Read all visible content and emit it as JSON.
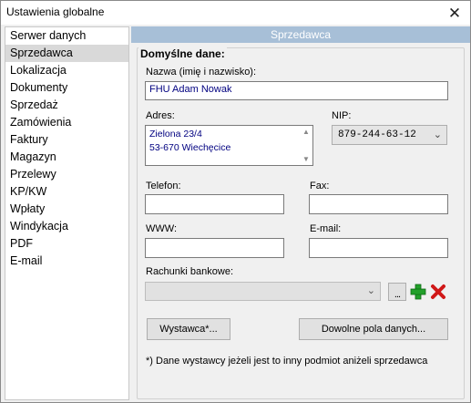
{
  "window": {
    "title": "Ustawienia globalne",
    "close_icon": "close-icon"
  },
  "sidebar": {
    "items": [
      {
        "label": "Serwer danych"
      },
      {
        "label": "Sprzedawca"
      },
      {
        "label": "Lokalizacja"
      },
      {
        "label": "Dokumenty"
      },
      {
        "label": "Sprzedaż"
      },
      {
        "label": "Zamówienia"
      },
      {
        "label": "Faktury"
      },
      {
        "label": "Magazyn"
      },
      {
        "label": "Przelewy"
      },
      {
        "label": "KP/KW"
      },
      {
        "label": "Wpłaty"
      },
      {
        "label": "Windykacja"
      },
      {
        "label": "PDF"
      },
      {
        "label": "E-mail"
      }
    ],
    "selected": "Sprzedawca"
  },
  "panel": {
    "header": "Sprzedawca",
    "group_title": "Domyślne dane:",
    "name": {
      "label": "Nazwa (imię i nazwisko):",
      "value": "FHU Adam Nowak"
    },
    "address": {
      "label": "Adres:",
      "lines": [
        "Zielona 23/4",
        "53-670 Wiechęcice"
      ]
    },
    "nip": {
      "label": "NIP:",
      "value": "879-244-63-12"
    },
    "phone": {
      "label": "Telefon:",
      "value": ""
    },
    "fax": {
      "label": "Fax:",
      "value": ""
    },
    "www": {
      "label": "WWW:",
      "value": ""
    },
    "email": {
      "label": "E-mail:",
      "value": ""
    },
    "bank": {
      "label": "Rachunki bankowe:",
      "value": ""
    },
    "buttons": {
      "issuer": "Wystawca*...",
      "custom_fields": "Dowolne pola danych..."
    },
    "footnote": "*) Dane wystawcy jeżeli jest to inny podmiot aniżeli sprzedawca"
  },
  "colors": {
    "header_bg": "#a7bfd7",
    "value_text": "#000080",
    "add_green": "#22a02a",
    "delete_red": "#d01818"
  }
}
